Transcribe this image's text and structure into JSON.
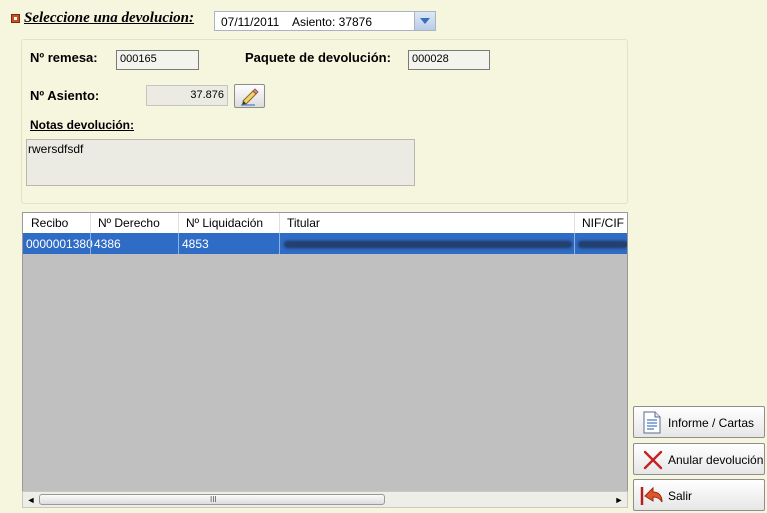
{
  "header": {
    "label": "Seleccione una devolucion:",
    "selected_value": "07/11/2011    Asiento: 37876"
  },
  "form": {
    "remesa_label": "Nº remesa:",
    "remesa_value": "000165",
    "paquete_label": "Paquete de devolución:",
    "paquete_value": "000028",
    "asiento_label": "Nº Asiento:",
    "asiento_value": "37.876",
    "notas_label": "Notas devolución:",
    "notas_value": "rwersdfsdf"
  },
  "grid": {
    "columns": [
      "Recibo",
      "Nº Derecho",
      "Nº Liquidación",
      "Titular",
      "NIF/CIF"
    ],
    "rows": [
      {
        "recibo": "0000001380",
        "derecho": "4386",
        "liquidacion": "4853"
      }
    ]
  },
  "scrollbar": {
    "grip": "III"
  },
  "buttons": {
    "informe": "Informe / Cartas",
    "anular": "Anular devolución",
    "salir": "Salir"
  },
  "colors": {
    "selection": "#2f6cc6",
    "background": "#f6f5de"
  }
}
